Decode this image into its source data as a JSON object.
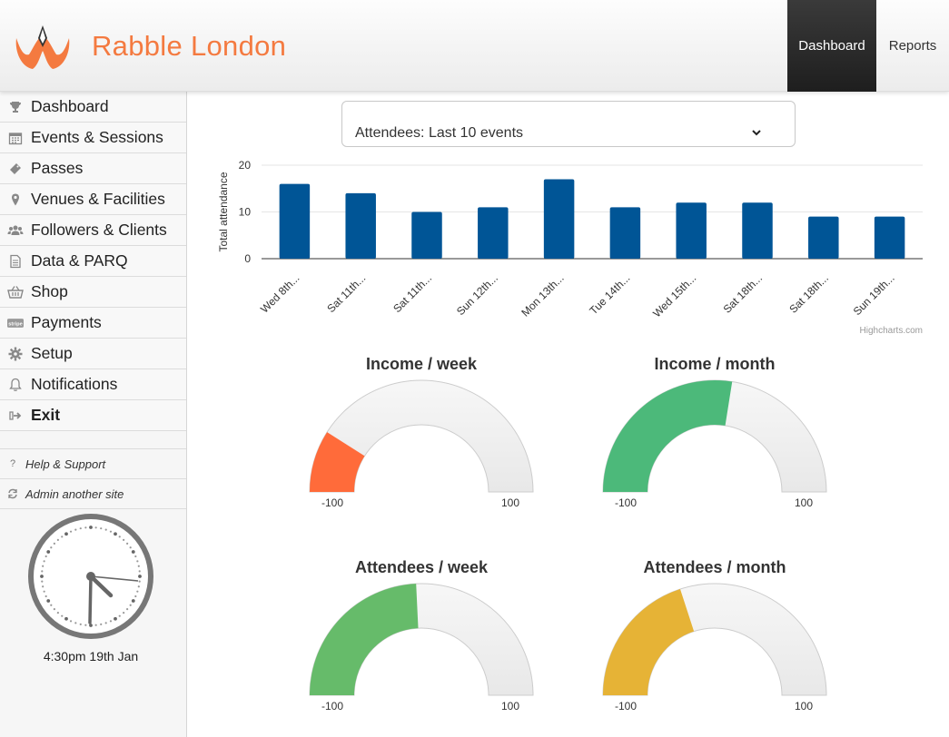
{
  "header": {
    "brand": "Rabble London",
    "nav": [
      {
        "label": "Dashboard",
        "active": true
      },
      {
        "label": "Reports",
        "active": false
      }
    ]
  },
  "sidebar": {
    "items": [
      {
        "label": "Dashboard",
        "icon": "trophy-icon"
      },
      {
        "label": "Events & Sessions",
        "icon": "calendar-icon"
      },
      {
        "label": "Passes",
        "icon": "ticket-icon"
      },
      {
        "label": "Venues & Facilities",
        "icon": "map-pin-icon"
      },
      {
        "label": "Followers & Clients",
        "icon": "users-icon"
      },
      {
        "label": "Data & PARQ",
        "icon": "document-icon"
      },
      {
        "label": "Shop",
        "icon": "basket-icon"
      },
      {
        "label": "Payments",
        "icon": "stripe-icon"
      },
      {
        "label": "Setup",
        "icon": "gear-icon"
      },
      {
        "label": "Notifications",
        "icon": "bell-icon"
      },
      {
        "label": "Exit",
        "icon": "exit-icon"
      }
    ],
    "help": "Help & Support",
    "admin": "Admin another site",
    "clock_text": "4:30pm 19th Jan",
    "stripe_badge": "stripe"
  },
  "selector": {
    "value": "Attendees: Last 10 events"
  },
  "chart_data": {
    "type": "bar",
    "categories": [
      "Wed 8th...",
      "Sat 11th...",
      "Sat 11th...",
      "Sun 12th...",
      "Mon 13th...",
      "Tue 14th...",
      "Wed 15th...",
      "Sat 18th...",
      "Sat 18th...",
      "Sun 19th..."
    ],
    "values": [
      16,
      14,
      10,
      11,
      17,
      11,
      12,
      12,
      9,
      9
    ],
    "ylabel": "Total attendance",
    "ylim": [
      0,
      20
    ],
    "yticks": [
      0,
      10,
      20
    ],
    "grid": true,
    "credit": "Highcharts.com",
    "color": "#005596"
  },
  "gauges": [
    {
      "title": "Income / week",
      "min": -100,
      "max": 100,
      "value": -64,
      "color": "#ff6b3a",
      "min_label": "-100",
      "max_label": "100"
    },
    {
      "title": "Income / month",
      "min": -100,
      "max": 100,
      "value": 10,
      "color": "#4cb97a",
      "min_label": "-100",
      "max_label": "100"
    },
    {
      "title": "Attendees / week",
      "min": -100,
      "max": 100,
      "value": -3,
      "color": "#66bb6a",
      "min_label": "-100",
      "max_label": "100"
    },
    {
      "title": "Attendees / month",
      "min": -100,
      "max": 100,
      "value": -20,
      "color": "#e6b336",
      "min_label": "-100",
      "max_label": "100"
    }
  ]
}
